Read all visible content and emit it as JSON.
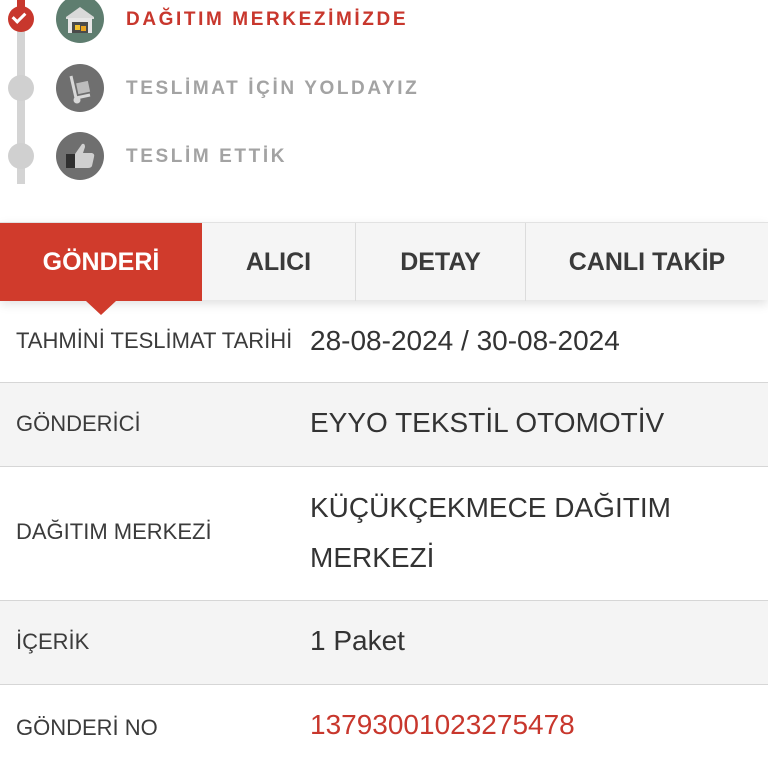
{
  "timeline": {
    "steps": [
      {
        "label": "DAĞITIM MERKEZİMİZDE",
        "status": "completed",
        "icon": "warehouse-icon"
      },
      {
        "label": "TESLİMAT İÇİN YOLDAYIZ",
        "status": "pending",
        "icon": "hand-truck-icon"
      },
      {
        "label": "TESLİM ETTİK",
        "status": "pending",
        "icon": "thumbs-up-icon"
      }
    ]
  },
  "tabs": [
    {
      "label": "GÖNDERİ",
      "active": true
    },
    {
      "label": "ALICI",
      "active": false
    },
    {
      "label": "DETAY",
      "active": false
    },
    {
      "label": "CANLI TAKİP",
      "active": false
    }
  ],
  "details": {
    "estimated_delivery": {
      "label": "TAHMİNİ TESLİMAT TARİHİ",
      "value": "28-08-2024 / 30-08-2024"
    },
    "sender": {
      "label": "GÖNDERİCİ",
      "value": "EYYO TEKSTİL OTOMOTİV"
    },
    "distribution_center": {
      "label": "DAĞITIM MERKEZİ",
      "value_line1": "KÜÇÜKÇEKMECE DAĞITIM",
      "value_line2": "MERKEZİ"
    },
    "content": {
      "label": "İÇERİK",
      "value": "1 Paket"
    },
    "shipment_no": {
      "label": "GÖNDERİ NO",
      "value": "13793001023275478"
    }
  },
  "colors": {
    "accent": "#c8372d",
    "inactive_text": "#a3a3a3",
    "row_alt": "#f4f4f4"
  }
}
